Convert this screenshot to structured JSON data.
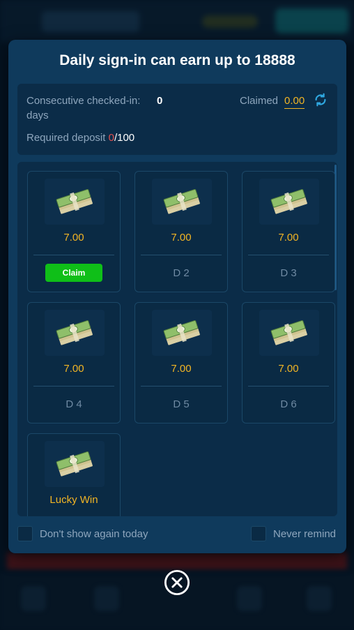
{
  "modal": {
    "title": "Daily sign-in can earn up to 18888",
    "consecutive_label": "Consecutive checked-in: days",
    "consecutive_value": "0",
    "claimed_label": "Claimed",
    "claimed_value": "0.00",
    "deposit_label": "Required deposit",
    "deposit_current": "0",
    "deposit_separator": "/",
    "deposit_total": "100",
    "days": [
      {
        "amount": "7.00",
        "label": "",
        "claim_label": "Claim",
        "claimable": true
      },
      {
        "amount": "7.00",
        "label": "D 2",
        "claimable": false
      },
      {
        "amount": "7.00",
        "label": "D 3",
        "claimable": false
      },
      {
        "amount": "7.00",
        "label": "D 4",
        "claimable": false
      },
      {
        "amount": "7.00",
        "label": "D 5",
        "claimable": false
      },
      {
        "amount": "7.00",
        "label": "D 6",
        "claimable": false
      }
    ],
    "lucky": {
      "label": "Lucky Win"
    },
    "dont_show_label": "Don't show again today",
    "never_remind_label": "Never remind"
  },
  "icons": {
    "refresh": "refresh-icon",
    "money": "money-stack-icon",
    "close": "close-circle-icon"
  },
  "colors": {
    "modal_bg": "#0f3a5c",
    "accent_gold": "#f2b524",
    "claim_green": "#0fbf18",
    "deposit_red": "#e04f4f"
  }
}
